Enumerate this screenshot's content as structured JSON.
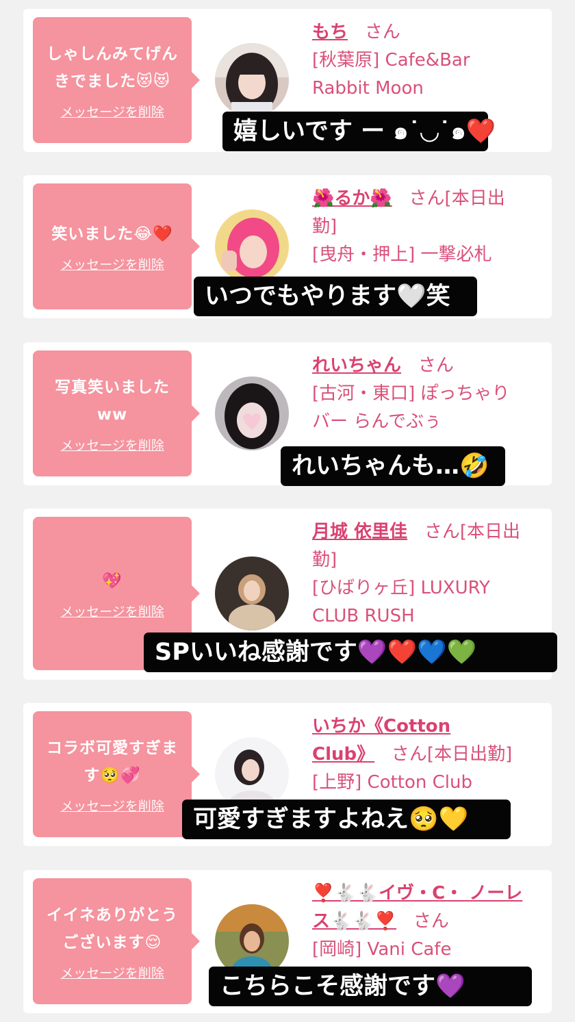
{
  "delete_label": "メッセージを削除",
  "san_label": "さん",
  "cards": [
    {
      "message": [
        "しゃしんみてげん",
        "きでました😻😻"
      ],
      "name": "もち",
      "name_suffix": "さん",
      "info": [
        "[秋葉原] Cafe&Bar",
        "Rabbit Moon"
      ],
      "caption": "嬉しいです ー ๑˙◡˙๑❤️"
    },
    {
      "message": [
        "笑いました😂❤️"
      ],
      "name": "🌺るか🌺",
      "name_suffix": "さん[本日出",
      "name_line2": "勤]",
      "info": [
        "[曳舟・押上] 一撃必札"
      ],
      "caption": "いつでもやります🤍笑"
    },
    {
      "message": [
        "写真笑いました",
        "ww"
      ],
      "name": "れいちゃん",
      "name_suffix": "さん",
      "info": [
        "[古河・東口] ぽっちゃり",
        "バー らんでぶぅ"
      ],
      "caption": "れいちゃんも…🤣"
    },
    {
      "message": [
        "💖"
      ],
      "name": "月城 依里佳",
      "name_suffix": "さん[本日出",
      "name_line2": "勤]",
      "info": [
        "[ひばりヶ丘] LUXURY",
        "CLUB RUSH"
      ],
      "caption": "SPいいね感謝です💜❤️💙💚"
    },
    {
      "message": [
        "コラボ可愛すぎま",
        "す🥺💞"
      ],
      "name": "いちか《Cotton",
      "name_line2": "Club》",
      "name_suffix": "さん[本日出勤]",
      "info": [
        "[上野] Cotton Club"
      ],
      "caption": "可愛すぎますよねえ🥺💛"
    },
    {
      "message": [
        "イイネありがとう",
        "ございます😌"
      ],
      "name": "❣️🐇🐇イヴ・C・ ノーレ",
      "name_line2": "ス🐇🐇❣️",
      "name_suffix": "さん",
      "info": [
        "[岡崎] Vani Cafe"
      ],
      "caption": "こちらこそ感謝です💜"
    }
  ],
  "colors": {
    "bubble": "#f5939e",
    "name": "#d94270",
    "info": "#d9507a",
    "page_bg": "#f1f1f1",
    "caption_bg": "#050505"
  }
}
